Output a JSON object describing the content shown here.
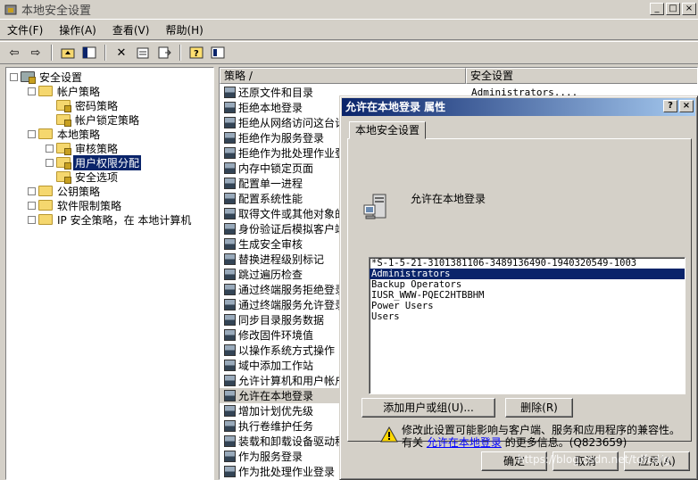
{
  "window": {
    "title": "本地安全设置",
    "min": "_",
    "max": "□",
    "close": "×"
  },
  "menu": [
    "文件(F)",
    "操作(A)",
    "查看(V)",
    "帮助(H)"
  ],
  "tree": [
    {
      "label": "安全设置",
      "level": 0,
      "expand": "−"
    },
    {
      "label": "帐户策略",
      "level": 1,
      "expand": "−"
    },
    {
      "label": "密码策略",
      "level": 2,
      "expand": ""
    },
    {
      "label": "帐户锁定策略",
      "level": 2,
      "expand": ""
    },
    {
      "label": "本地策略",
      "level": 1,
      "expand": "−"
    },
    {
      "label": "审核策略",
      "level": 2,
      "expand": "+"
    },
    {
      "label": "用户权限分配",
      "level": 2,
      "expand": "+",
      "selected": true
    },
    {
      "label": "安全选项",
      "level": 2,
      "expand": ""
    },
    {
      "label": "公钥策略",
      "level": 1,
      "expand": "+"
    },
    {
      "label": "软件限制策略",
      "level": 1,
      "expand": "+"
    },
    {
      "label": "IP 安全策略，在 本地计算机",
      "level": 1,
      "expand": "+"
    }
  ],
  "list": {
    "headers": [
      "策略 /",
      "安全设置"
    ],
    "rows": [
      {
        "name": "还原文件和目录",
        "setting": "Administrators,..."
      },
      {
        "name": "拒绝本地登录",
        "setting": ""
      },
      {
        "name": "拒绝从网络访问这台计",
        "setting": ""
      },
      {
        "name": "拒绝作为服务登录",
        "setting": ""
      },
      {
        "name": "拒绝作为批处理作业登",
        "setting": ""
      },
      {
        "name": "内存中锁定页面",
        "setting": ""
      },
      {
        "name": "配置单一进程",
        "setting": ""
      },
      {
        "name": "配置系统性能",
        "setting": ""
      },
      {
        "name": "取得文件或其他对象的",
        "setting": ""
      },
      {
        "name": "身份验证后模拟客户端",
        "setting": ""
      },
      {
        "name": "生成安全审核",
        "setting": ""
      },
      {
        "name": "替换进程级别标记",
        "setting": ""
      },
      {
        "name": "跳过遍历检查",
        "setting": ""
      },
      {
        "name": "通过终端服务拒绝登录",
        "setting": ""
      },
      {
        "name": "通过终端服务允许登录",
        "setting": ""
      },
      {
        "name": "同步目录服务数据",
        "setting": ""
      },
      {
        "name": "修改固件环境值",
        "setting": ""
      },
      {
        "name": "以操作系统方式操作",
        "setting": ""
      },
      {
        "name": "域中添加工作站",
        "setting": ""
      },
      {
        "name": "允许计算机和用户帐户",
        "setting": ""
      },
      {
        "name": "允许在本地登录",
        "setting": "",
        "highlight": true
      },
      {
        "name": "增加计划优先级",
        "setting": ""
      },
      {
        "name": "执行卷维护任务",
        "setting": ""
      },
      {
        "name": "装载和卸载设备驱动程",
        "setting": ""
      },
      {
        "name": "作为服务登录",
        "setting": ""
      },
      {
        "name": "作为批处理作业登录",
        "setting": ""
      }
    ]
  },
  "dialog": {
    "title": "允许在本地登录 属性",
    "help": "?",
    "close": "×",
    "tab": "本地安全设置",
    "policy_name": "允许在本地登录",
    "accounts": [
      {
        "name": "*S-1-5-21-3101381106-3489136490-1940320549-1003",
        "selected": false
      },
      {
        "name": "Administrators",
        "selected": true
      },
      {
        "name": "Backup Operators",
        "selected": false
      },
      {
        "name": "IUSR_WWW-PQEC2HTBBHM",
        "selected": false
      },
      {
        "name": "Power Users",
        "selected": false
      },
      {
        "name": "Users",
        "selected": false
      }
    ],
    "add_button": "添加用户或组(U)...",
    "remove_button": "删除(R)",
    "warning_line1": "修改此设置可能影响与客户端、服务和应用程序的兼容性。",
    "warning_prefix": "有关",
    "warning_link": "允许在本地登录",
    "warning_suffix": "的更多信息。(Q823659)",
    "ok": "确定",
    "cancel": "取消",
    "apply": "应用(A)"
  },
  "watermark": "https://blog.csdn.net/tdfcd/g"
}
